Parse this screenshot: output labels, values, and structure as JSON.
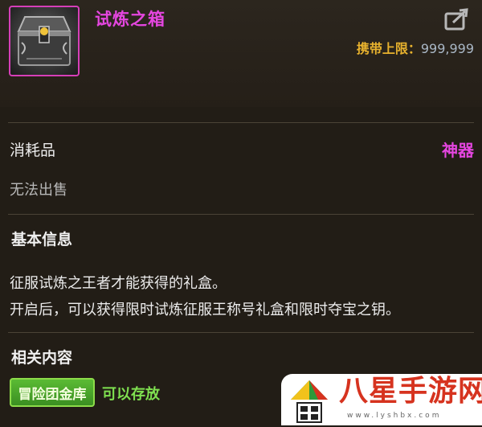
{
  "item": {
    "name": "试炼之箱",
    "icon": "treasure-chest-icon",
    "rarity_color": "#e546e0",
    "carry_limit_label": "携带上限：",
    "carry_limit_value": "999,999"
  },
  "category": {
    "type": "消耗品",
    "grade": "神器",
    "trade_status": "无法出售"
  },
  "basic_info": {
    "title": "基本信息",
    "lines": [
      "征服试炼之王者才能获得的礼盒。",
      "开启后，可以获得限时试炼征服王称号礼盒和限时夺宝之钥。"
    ]
  },
  "related": {
    "title": "相关内容",
    "tag_label": "冒险团金库",
    "tag_note": "可以存放"
  },
  "watermark": {
    "text": "八星手游网",
    "url": "www.lyshbx.com"
  }
}
